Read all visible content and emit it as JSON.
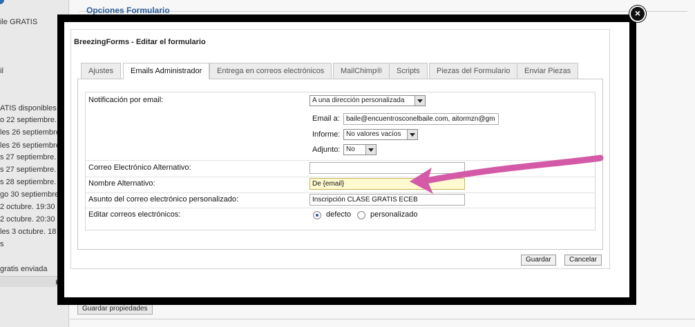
{
  "background": {
    "sidebar_lines": [
      "ile GRATIS",
      "il",
      "ATIS disponibles",
      "o 22 septiembre.",
      "les 26 septiembre",
      "les 26 septiembre",
      "s 27 septiembre.",
      "s 27 septiembre.",
      "s 28 septiembre.",
      "go 30 septiembre.",
      "2 octubre. 19:30",
      "2 octubre. 20:30",
      "les 3 octubre. 18",
      "s",
      "gratis enviada"
    ],
    "fieldset_title": "Opciones Formulario",
    "save_properties_label": "Guardar propiedades"
  },
  "modal": {
    "close_glyph": "×",
    "title": "BreezingForms - Editar el formulario",
    "tabs": [
      {
        "label": "Ajustes",
        "active": false
      },
      {
        "label": "Emails Administrador",
        "active": true
      },
      {
        "label": "Entrega en correos electrónicos",
        "active": false
      },
      {
        "label": "MailChimp®",
        "active": false
      },
      {
        "label": "Scripts",
        "active": false
      },
      {
        "label": "Piezas del Formulario",
        "active": false
      },
      {
        "label": "Enviar Piezas",
        "active": false
      }
    ],
    "form": {
      "notification_label": "Notificación por email:",
      "notification_value": "A una dirección personalizada",
      "email_label": "Email a:",
      "email_value": "baile@encuentrosconelbaile.com, aitormzn@gm",
      "report_label": "Informe:",
      "report_value": "No valores vacíos",
      "attachment_label": "Adjunto:",
      "attachment_value": "No",
      "alt_email_label": "Correo Electrónico Alternativo:",
      "alt_email_value": "",
      "alt_name_label": "Nombre Alternativo:",
      "alt_name_value": "De {email}",
      "subject_label": "Asunto del correo electrónico personalizado:",
      "subject_value": "Inscripción CLASE GRATIS ECEB",
      "edit_emails_label": "Editar correos electrónicos:",
      "radio_default_label": "defecto",
      "radio_custom_label": "personalizado",
      "selected_radio": "defecto"
    },
    "buttons": {
      "save_label": "Guardar",
      "cancel_label": "Cancelar"
    }
  },
  "colors": {
    "annotation_arrow": "#d45aa8",
    "tab_active_bg": "#ffffff",
    "focused_input_bg": "#fff9cf",
    "overlay_frame": "#000000"
  }
}
